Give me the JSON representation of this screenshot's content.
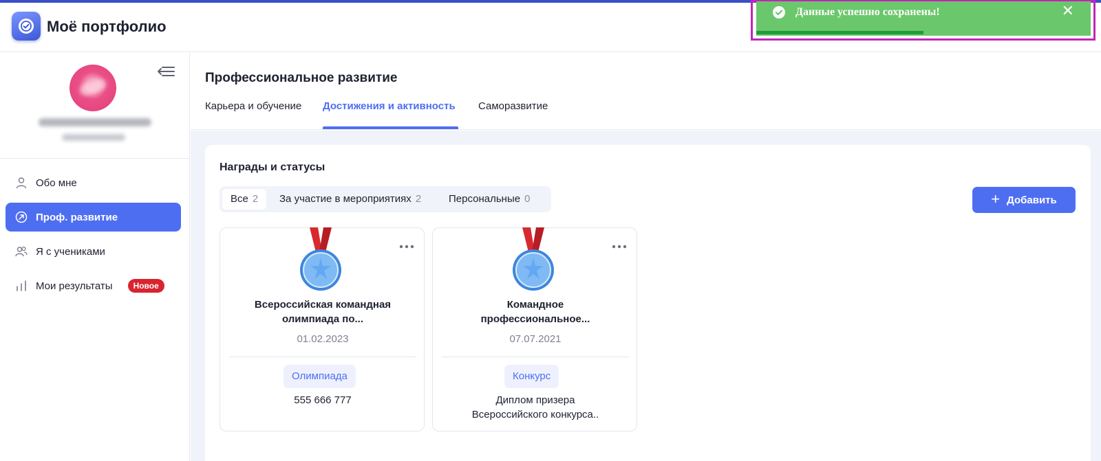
{
  "app": {
    "title": "Моё портфолио"
  },
  "sidebar": {
    "items": [
      {
        "label": "Обо мне",
        "icon": "user-icon"
      },
      {
        "label": "Проф. развитие",
        "icon": "compass-icon",
        "active": true
      },
      {
        "label": "Я с учениками",
        "icon": "users-icon"
      },
      {
        "label": "Мои результаты",
        "icon": "bar-chart-icon",
        "badge": "Новое"
      }
    ]
  },
  "page": {
    "title": "Профессиональное развитие",
    "tabs": [
      {
        "label": "Карьера и обучение"
      },
      {
        "label": "Достижения и активность",
        "active": true
      },
      {
        "label": "Саморазвитие"
      }
    ]
  },
  "awards": {
    "title": "Награды и статусы",
    "filters": [
      {
        "label": "Все",
        "count": "2",
        "active": true
      },
      {
        "label": "За участие в мероприятиях",
        "count": "2"
      },
      {
        "label": "Персональные",
        "count": "0"
      }
    ],
    "add_label": "Добавить",
    "cards": [
      {
        "name_line1": "Всероссийская командная",
        "name_line2": "олимпиада по...",
        "date": "01.02.2023",
        "tag": "Олимпиада",
        "desc_line1": "555 666 777",
        "desc_line2": ""
      },
      {
        "name_line1": "Командное",
        "name_line2": "профессиональное...",
        "date": "07.07.2021",
        "tag": "Конкурс",
        "desc_line1": "Диплом призера",
        "desc_line2": "Всероссийского конкурса.."
      }
    ]
  },
  "toast": {
    "message": "Данные успешно сохранены!",
    "close_glyph": "✕",
    "progress": 0.5
  },
  "colors": {
    "accent": "#4e6ef2",
    "toast_bg": "#6bc76b",
    "toast_progress": "#1f9c3a",
    "badge": "#d8242f",
    "medal_ribbon": "#d8292f",
    "medal": "#4a96e8"
  }
}
